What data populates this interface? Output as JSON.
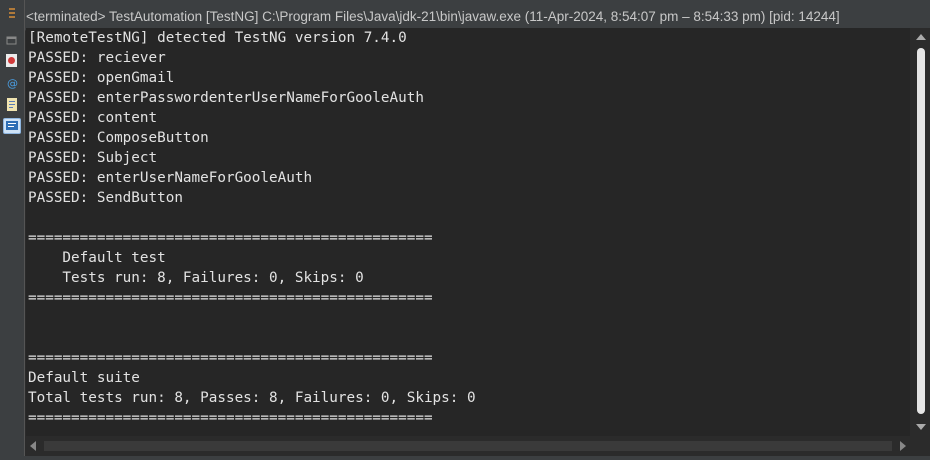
{
  "window": {
    "title": "<terminated> TestAutomation [TestNG] C:\\Program Files\\Java\\jdk-21\\bin\\javaw.exe  (11-Apr-2024, 8:54:07 pm – 8:54:33 pm) [pid: 14244]"
  },
  "sidebar": {
    "icons": [
      "view-menu-icon",
      "minimize-icon",
      "testng-results-icon",
      "console-at-icon",
      "problems-icon",
      "console-view-icon"
    ]
  },
  "console": {
    "lines": [
      "[RemoteTestNG] detected TestNG version 7.4.0",
      "PASSED: reciever",
      "PASSED: openGmail",
      "PASSED: enterPasswordenterUserNameForGooleAuth",
      "PASSED: content",
      "PASSED: ComposeButton",
      "PASSED: Subject",
      "PASSED: enterUserNameForGooleAuth",
      "PASSED: SendButton",
      "",
      "===============================================",
      "    Default test",
      "    Tests run: 8, Failures: 0, Skips: 0",
      "===============================================",
      "",
      "",
      "===============================================",
      "Default suite",
      "Total tests run: 8, Passes: 8, Failures: 0, Skips: 0",
      "==============================================="
    ]
  },
  "colors": {
    "console_bg": "#262626",
    "text": "#e2e2e2",
    "chrome": "#3c3f41"
  }
}
